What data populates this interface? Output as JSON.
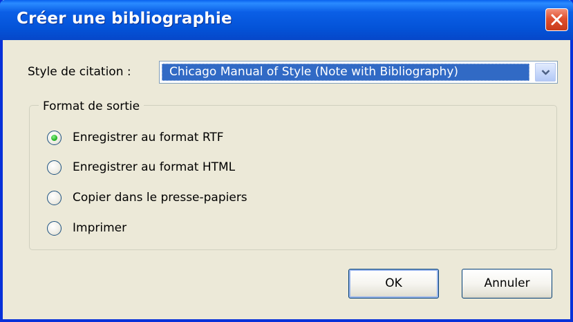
{
  "window": {
    "title": "Créer une bibliographie"
  },
  "citation_style": {
    "label": "Style de citation :",
    "selected": "Chicago Manual of Style (Note with Bibliography)"
  },
  "output_format": {
    "legend": "Format de sortie",
    "options": [
      {
        "label": "Enregistrer au format RTF",
        "selected": true
      },
      {
        "label": "Enregistrer au format HTML",
        "selected": false
      },
      {
        "label": "Copier dans le presse-papiers",
        "selected": false
      },
      {
        "label": "Imprimer",
        "selected": false
      }
    ]
  },
  "buttons": {
    "ok": "OK",
    "cancel": "Annuler"
  },
  "colors": {
    "titlebar": "#0453d8",
    "dialog_bg": "#ece9d8",
    "selection": "#316ac5",
    "close_button": "#e0502e",
    "radio_selected": "#2dbb2d"
  }
}
